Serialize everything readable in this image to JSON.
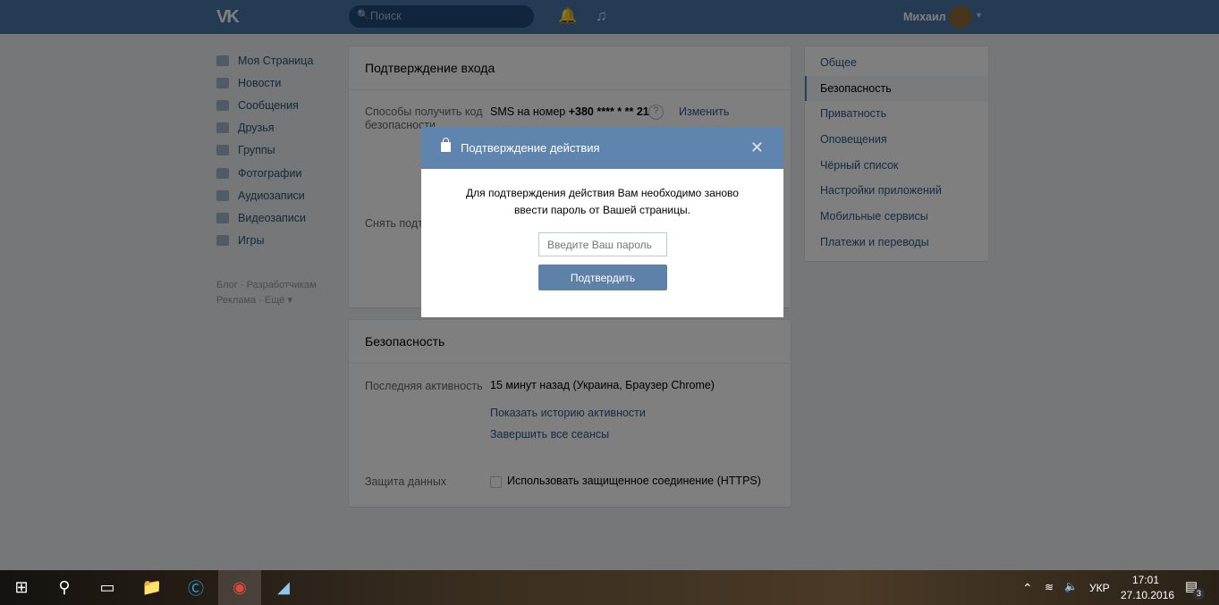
{
  "header": {
    "logo": "VK",
    "search_placeholder": "Поиск",
    "user_name": "Михаил"
  },
  "sidebar": {
    "items": [
      {
        "label": "Моя Страница"
      },
      {
        "label": "Новости"
      },
      {
        "label": "Сообщения"
      },
      {
        "label": "Друзья"
      },
      {
        "label": "Группы"
      },
      {
        "label": "Фотографии"
      },
      {
        "label": "Аудиозаписи"
      },
      {
        "label": "Видеозаписи"
      },
      {
        "label": "Игры"
      }
    ],
    "footer_links": [
      "Блог",
      "Разработчикам",
      "Реклама",
      "Ещё"
    ]
  },
  "login_confirm": {
    "title": "Подтверждение входа",
    "methods_label": "Способы получить код безопасности",
    "methods_value_prefix": "SMS на номер ",
    "phone": "+380 **** * ** 21",
    "help": "?",
    "change": "Изменить",
    "remove_label": "Снять подтверждение"
  },
  "security": {
    "title": "Безопасность",
    "last_activity_label": "Последняя активность",
    "last_activity_value": "15 минут назад (Украина, Браузер Chrome)",
    "show_history": "Показать историю активности",
    "end_sessions": "Завершить все сеансы",
    "data_protection_label": "Защита данных",
    "https_label": "Использовать защищенное соединение (HTTPS)",
    "https_checked": false
  },
  "settings_menu": {
    "items": [
      {
        "label": "Общее"
      },
      {
        "label": "Безопасность",
        "active": true
      },
      {
        "label": "Приватность"
      },
      {
        "label": "Оповещения"
      },
      {
        "label": "Чёрный список"
      },
      {
        "label": "Настройки приложений"
      },
      {
        "label": "Мобильные сервисы"
      },
      {
        "label": "Платежи и переводы"
      }
    ]
  },
  "modal": {
    "title": "Подтверждение действия",
    "text": "Для подтверждения действия Вам необходимо заново ввести пароль от Вашей страницы.",
    "password_placeholder": "Введите Ваш пароль",
    "confirm": "Подтвердить"
  },
  "taskbar": {
    "language": "УКР",
    "time": "17:01",
    "date": "27.10.2016",
    "notifications": "3"
  }
}
